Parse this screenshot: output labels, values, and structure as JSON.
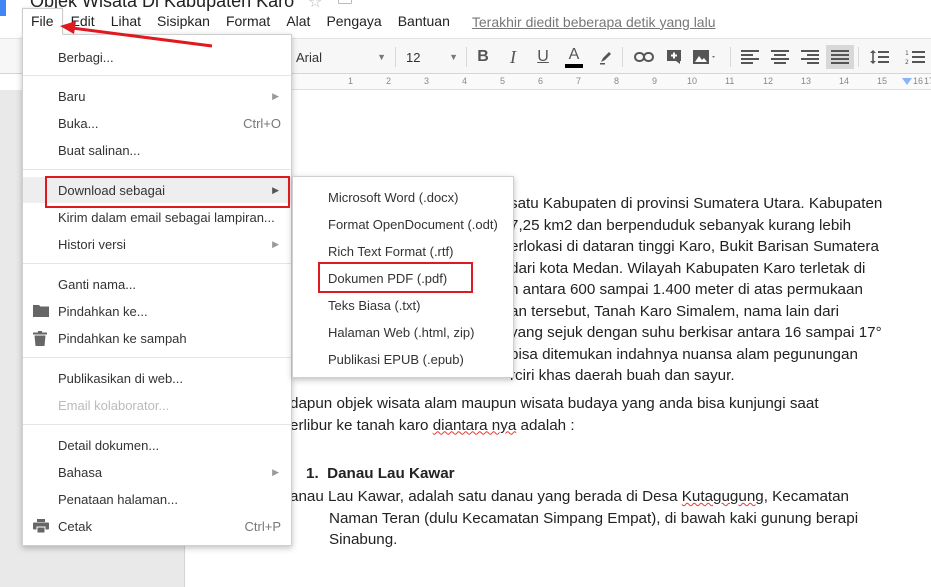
{
  "document": {
    "title": "Objek Wisata Di Kabupaten Karo",
    "last_edit": "Terakhir diedit beberapa detik yang lalu"
  },
  "menubar": {
    "items": [
      "File",
      "Edit",
      "Lihat",
      "Sisipkan",
      "Format",
      "Alat",
      "Pengaya",
      "Bantuan"
    ]
  },
  "toolbar": {
    "font": "Arial",
    "font_size": "12",
    "bold": "B",
    "italic": "I",
    "underline": "U",
    "text_color": "A",
    "text_color_value": "#000000"
  },
  "ruler": {
    "ticks": [
      "1",
      "2",
      "3",
      "4",
      "5",
      "6",
      "7",
      "8",
      "9",
      "10",
      "11",
      "12",
      "13",
      "14",
      "15",
      "16",
      "17"
    ]
  },
  "file_menu": {
    "share": "Berbagi...",
    "new": "Baru",
    "open": "Buka...",
    "open_shortcut": "Ctrl+O",
    "copy": "Buat salinan...",
    "download_as": "Download sebagai",
    "email_attachment": "Kirim dalam email sebagai lampiran...",
    "version_history": "Histori versi",
    "rename": "Ganti nama...",
    "move_to": "Pindahkan ke...",
    "move_to_trash": "Pindahkan ke sampah",
    "publish": "Publikasikan di web...",
    "email_collaborators": "Email kolaborator...",
    "doc_details": "Detail dokumen...",
    "language": "Bahasa",
    "page_setup": "Penataan halaman...",
    "print": "Cetak",
    "print_shortcut": "Ctrl+P"
  },
  "download_submenu": {
    "items": [
      "Microsoft Word (.docx)",
      "Format OpenDocument (.odt)",
      "Rich Text Format (.rtf)",
      "Dokumen PDF (.pdf)",
      "Teks Biasa (.txt)",
      "Halaman Web (.html, zip)",
      "Publikasi EPUB (.epub)"
    ]
  },
  "body": {
    "p1_lines": [
      "satu Kabupaten di provinsi Sumatera Utara. Kabupaten",
      "7,25 km2 dan berpenduduk sebanyak kurang lebih",
      "erlokasi di dataran tinggi Karo, Bukit Barisan Sumatera",
      "dari kota Medan. Wilayah Kabupaten Karo terletak di",
      "n antara 600 sampai 1.400 meter di atas permukaan",
      "an tersebut, Tanah Karo Simalem, nama lain dari",
      "yang sejuk dengan suhu berkisar antara 16 sampai 17°",
      "bisa ditemukan indahnya nuansa alam pegunungan",
      "rciri khas daerah buah dan sayur."
    ],
    "p2_line1": "dapun objek wisata alam maupun wisata budaya yang anda bisa kunjungi saat",
    "p2_line2_a": "erlibur ke tanah karo ",
    "p2_line2_b": "diantara nya",
    "p2_line2_c": " adalah :",
    "heading_num": "1.",
    "heading": "Danau Lau Kawar",
    "p3_line1_a": "anau Lau Kawar, adalah satu danau yang berada di Desa ",
    "p3_line1_b": "Kutagugung",
    "p3_line1_c": ", Kecamatan",
    "p3_line2": "Naman Teran (dulu Kecamatan Simpang Empat), di bawah kaki gunung berapi",
    "p3_line3": "Sinabung."
  },
  "colors": {
    "highlight_box": "#e0181f",
    "menu_hover": "#eeeeee",
    "page_bg": "#ffffff",
    "canvas_bg": "#e9e9e9"
  }
}
